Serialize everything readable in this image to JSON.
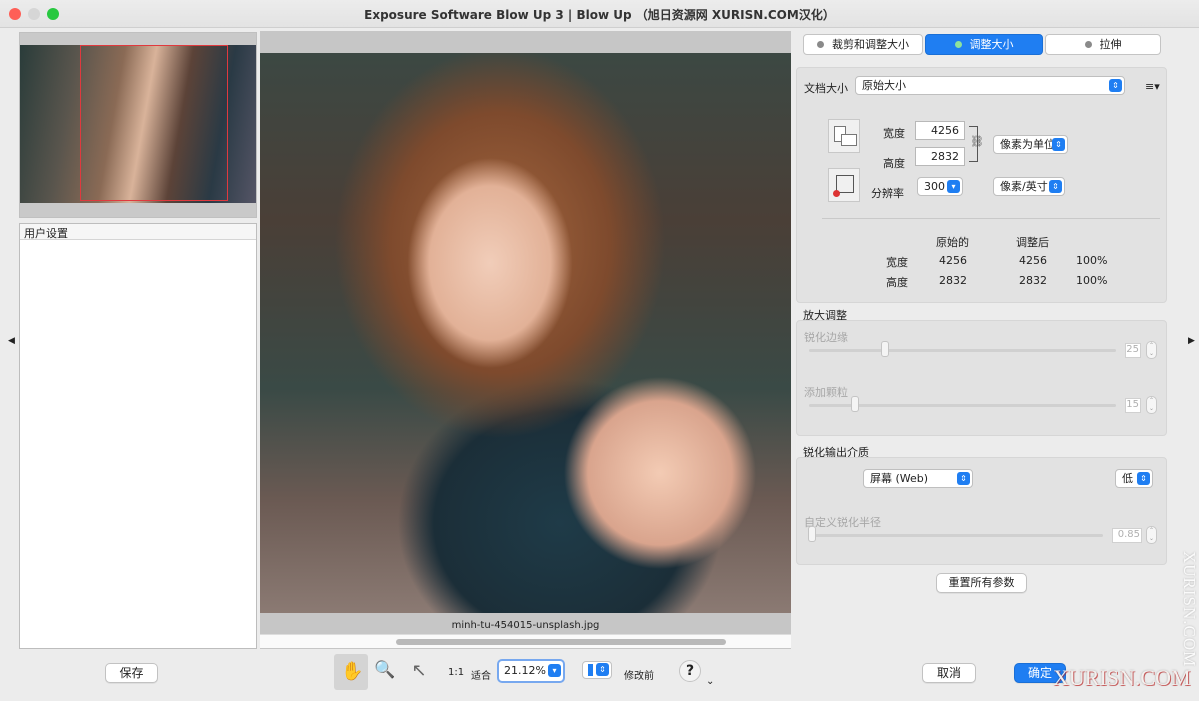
{
  "window": {
    "title": "Exposure Software Blow Up 3 | Blow Up （旭日资源网 XURISN.COM汉化）",
    "traffic_lights": {
      "close": "#fe5f57",
      "minimize": "#febc2e",
      "zoom": "#28c840"
    }
  },
  "left": {
    "user_settings_label": "用户设置",
    "save_label": "保存",
    "collapse_arrow": "◀"
  },
  "center": {
    "filename": "minh-tu-454015-unsplash.jpg",
    "toolbar": {
      "hand_icon": "✋",
      "zoom_icon": "🔍",
      "pointer_icon": "↖",
      "one_to_one": "1:1",
      "fit": "适合",
      "zoom_value": "21.12%",
      "before_label": "修改前",
      "help_icon": "?",
      "help_chevron": "⌄"
    }
  },
  "right": {
    "expand_arrow": "▶",
    "tabs": [
      {
        "label": "裁剪和调整大小",
        "active": false
      },
      {
        "label": "调整大小",
        "active": true
      },
      {
        "label": "拉伸",
        "active": false
      }
    ],
    "doc_size_label": "文档大小",
    "doc_size_value": "原始大小",
    "menu_icon": "≡▾",
    "width_label": "宽度",
    "width_value": "4256",
    "height_label": "高度",
    "height_value": "2832",
    "resolution_label": "分辨率",
    "resolution_value": "300",
    "unit_value": "像素为单位",
    "res_unit_value": "像素/英寸",
    "table": {
      "headers": [
        "原始的",
        "调整后"
      ],
      "rows": [
        {
          "label": "宽度",
          "original": "4256",
          "adjusted": "4256",
          "percent": "100%"
        },
        {
          "label": "高度",
          "original": "2832",
          "adjusted": "2832",
          "percent": "100%"
        }
      ]
    },
    "upscale": {
      "title": "放大调整",
      "sharpen_edges_label": "锐化边缘",
      "sharpen_edges_value": "25",
      "grain_label": "添加颗粒",
      "grain_value": "15"
    },
    "output": {
      "title": "锐化输出介质",
      "media_value": "屏幕 (Web)",
      "level_value": "低",
      "radius_label": "自定义锐化半径",
      "radius_value": "0.85"
    },
    "reset_label": "重置所有参数",
    "cancel_label": "取消",
    "ok_label": "确定"
  },
  "watermarks": {
    "vertical": "XURISN.COM",
    "corner": "XURISN.COM"
  }
}
